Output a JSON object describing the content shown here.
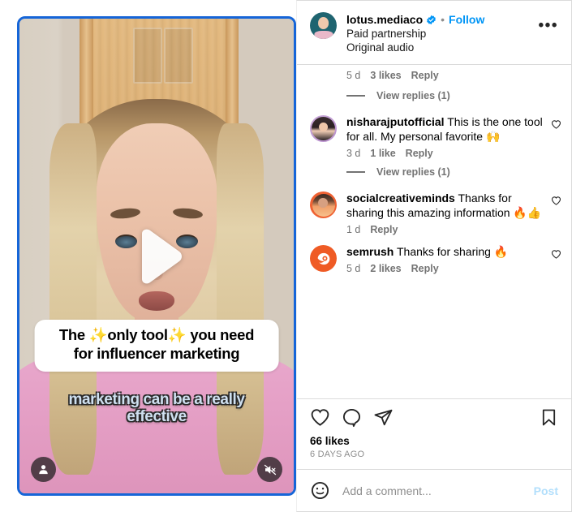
{
  "post": {
    "header": {
      "username": "lotus.mediaco",
      "verified_icon": "verified-badge-icon",
      "separator": "•",
      "follow_label": "Follow",
      "subtitle_line1": "Paid partnership",
      "subtitle_line2": "Original audio",
      "more_options_icon": "ellipsis-icon",
      "avatar_name": "lotus-mediaco-avatar"
    },
    "video": {
      "caption_overlay_line1": "The ✨only tool✨ you need",
      "caption_overlay_line2": "for influencer marketing",
      "subtitle_line1": "marketing can be a really",
      "subtitle_line2": "effective",
      "play_icon": "play-icon",
      "profile_icon": "person-icon",
      "mute_icon": "audio-muted-icon",
      "border_color": "#1565D8"
    },
    "caption_meta": {
      "age": "5 d",
      "likes": "3 likes",
      "reply": "Reply"
    },
    "view_replies_top": "View replies (1)",
    "comments": [
      {
        "avatar_name": "nisharajputofficial-avatar",
        "username": "nisharajputofficial",
        "text": " This is the one tool for all. My personal favorite 🙌",
        "age": "3 d",
        "likes": "1 like",
        "reply": "Reply",
        "like_icon": "heart-outline-icon",
        "view_replies": "View replies (1)"
      },
      {
        "avatar_name": "socialcreativeminds-avatar",
        "username": "socialcreativeminds",
        "text": " Thanks for sharing this amazing information 🔥👍",
        "age": "1 d",
        "likes": "",
        "reply": "Reply",
        "like_icon": "heart-outline-icon",
        "view_replies": ""
      },
      {
        "avatar_name": "semrush-avatar",
        "username": "semrush",
        "text": " Thanks for sharing 🔥",
        "age": "5 d",
        "likes": "2 likes",
        "reply": "Reply",
        "like_icon": "heart-outline-icon",
        "view_replies": ""
      }
    ],
    "actions": {
      "like_icon": "heart-outline-icon",
      "comment_icon": "comment-bubble-icon",
      "share_icon": "share-paperplane-icon",
      "save_icon": "bookmark-outline-icon",
      "likes_count": "66 likes",
      "post_date": "6 DAYS AGO"
    },
    "add_comment": {
      "emoji_icon": "emoji-smiley-icon",
      "placeholder": "Add a comment...",
      "value": "",
      "post_label": "Post"
    }
  },
  "colors": {
    "link_blue": "#0095f6",
    "post_blue_muted": "#b2dffc",
    "meta_gray": "#737373",
    "border_gray": "#dbdbdb",
    "semrush_orange": "#ef5b25"
  }
}
